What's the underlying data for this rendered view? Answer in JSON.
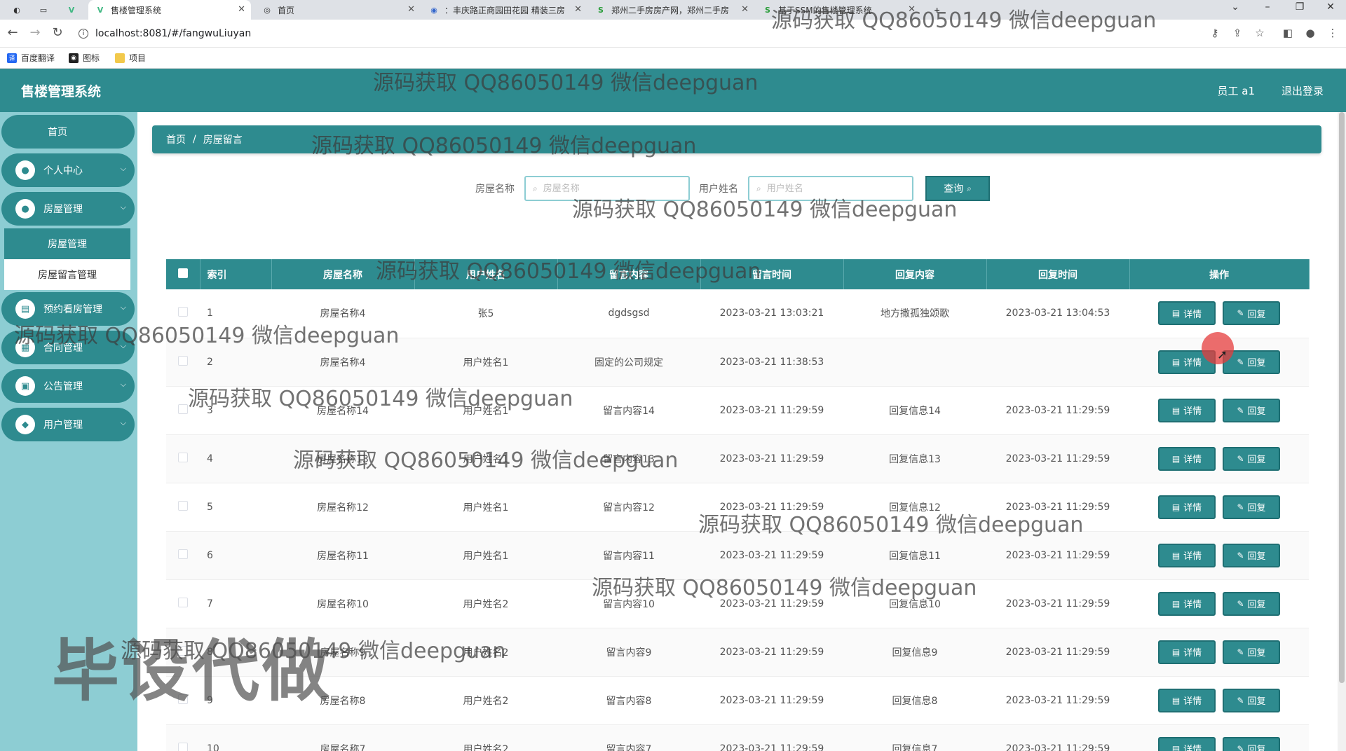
{
  "browser": {
    "tabs": [
      {
        "label": "售楼管理系统",
        "icon": "V"
      },
      {
        "label": "首页",
        "icon": "◎"
      },
      {
        "label": "：丰庆路正商园田花园 精装三房",
        "icon": "◉"
      },
      {
        "label": "郑州二手房房产网，郑州二手房",
        "icon": "S"
      },
      {
        "label": "基于SSM的售楼管理系统",
        "icon": "S"
      }
    ],
    "url": "localhost:8081/#/fangwuLiuyan",
    "bookmarks": [
      "百度翻译",
      "图标",
      "项目"
    ]
  },
  "header": {
    "title": "售楼管理系统",
    "user": "员工 a1",
    "logout": "退出登录"
  },
  "sidebar": {
    "home": "首页",
    "items": [
      {
        "label": "个人中心",
        "icon": "user-icon"
      },
      {
        "label": "房屋管理",
        "icon": "user-icon"
      },
      {
        "label": "预约看房管理",
        "icon": "calendar-icon"
      },
      {
        "label": "合同管理",
        "icon": "grid-icon"
      },
      {
        "label": "公告管理",
        "icon": "notice-icon"
      },
      {
        "label": "用户管理",
        "icon": "location-icon"
      }
    ],
    "subitems": [
      "房屋管理",
      "房屋留言管理"
    ]
  },
  "breadcrumb": {
    "home": "首页",
    "sep": "/",
    "current": "房屋留言"
  },
  "search": {
    "house_label": "房屋名称",
    "house_placeholder": "房屋名称",
    "user_label": "用户姓名",
    "user_placeholder": "用户姓名",
    "query_button": "查询"
  },
  "table": {
    "columns": [
      "索引",
      "房屋名称",
      "用户姓名",
      "留言内容",
      "留言时间",
      "回复内容",
      "回复时间",
      "操作"
    ],
    "detail_btn": "详情",
    "reply_btn": "回复",
    "rows": [
      {
        "idx": "1",
        "house": "房屋名称4",
        "user": "张5",
        "content": "dgdsgsd",
        "time": "2023-03-21 13:03:21",
        "reply": "地方撒孤独颂歌",
        "reply_time": "2023-03-21 13:04:53"
      },
      {
        "idx": "2",
        "house": "房屋名称4",
        "user": "用户姓名1",
        "content": "固定的公司规定",
        "time": "2023-03-21 11:38:53",
        "reply": "",
        "reply_time": ""
      },
      {
        "idx": "3",
        "house": "房屋名称14",
        "user": "用户姓名1",
        "content": "留言内容14",
        "time": "2023-03-21 11:29:59",
        "reply": "回复信息14",
        "reply_time": "2023-03-21 11:29:59"
      },
      {
        "idx": "4",
        "house": "房屋名称13",
        "user": "用户姓名1",
        "content": "留言内容13",
        "time": "2023-03-21 11:29:59",
        "reply": "回复信息13",
        "reply_time": "2023-03-21 11:29:59"
      },
      {
        "idx": "5",
        "house": "房屋名称12",
        "user": "用户姓名1",
        "content": "留言内容12",
        "time": "2023-03-21 11:29:59",
        "reply": "回复信息12",
        "reply_time": "2023-03-21 11:29:59"
      },
      {
        "idx": "6",
        "house": "房屋名称11",
        "user": "用户姓名1",
        "content": "留言内容11",
        "time": "2023-03-21 11:29:59",
        "reply": "回复信息11",
        "reply_time": "2023-03-21 11:29:59"
      },
      {
        "idx": "7",
        "house": "房屋名称10",
        "user": "用户姓名2",
        "content": "留言内容10",
        "time": "2023-03-21 11:29:59",
        "reply": "回复信息10",
        "reply_time": "2023-03-21 11:29:59"
      },
      {
        "idx": "8",
        "house": "房屋名称9",
        "user": "用户姓名2",
        "content": "留言内容9",
        "time": "2023-03-21 11:29:59",
        "reply": "回复信息9",
        "reply_time": "2023-03-21 11:29:59"
      },
      {
        "idx": "9",
        "house": "房屋名称8",
        "user": "用户姓名2",
        "content": "留言内容8",
        "time": "2023-03-21 11:29:59",
        "reply": "回复信息8",
        "reply_time": "2023-03-21 11:29:59"
      },
      {
        "idx": "10",
        "house": "房屋名称7",
        "user": "用户姓名2",
        "content": "留言内容7",
        "time": "2023-03-21 11:29:59",
        "reply": "回复信息7",
        "reply_time": "2023-03-21 11:29:59"
      }
    ]
  },
  "watermark": {
    "text": "源码获取 QQ86050149 微信deepguan",
    "big": "毕设代做"
  },
  "colors": {
    "primary": "#2e8b8f",
    "sidebar_bg": "#8dcdd3"
  }
}
